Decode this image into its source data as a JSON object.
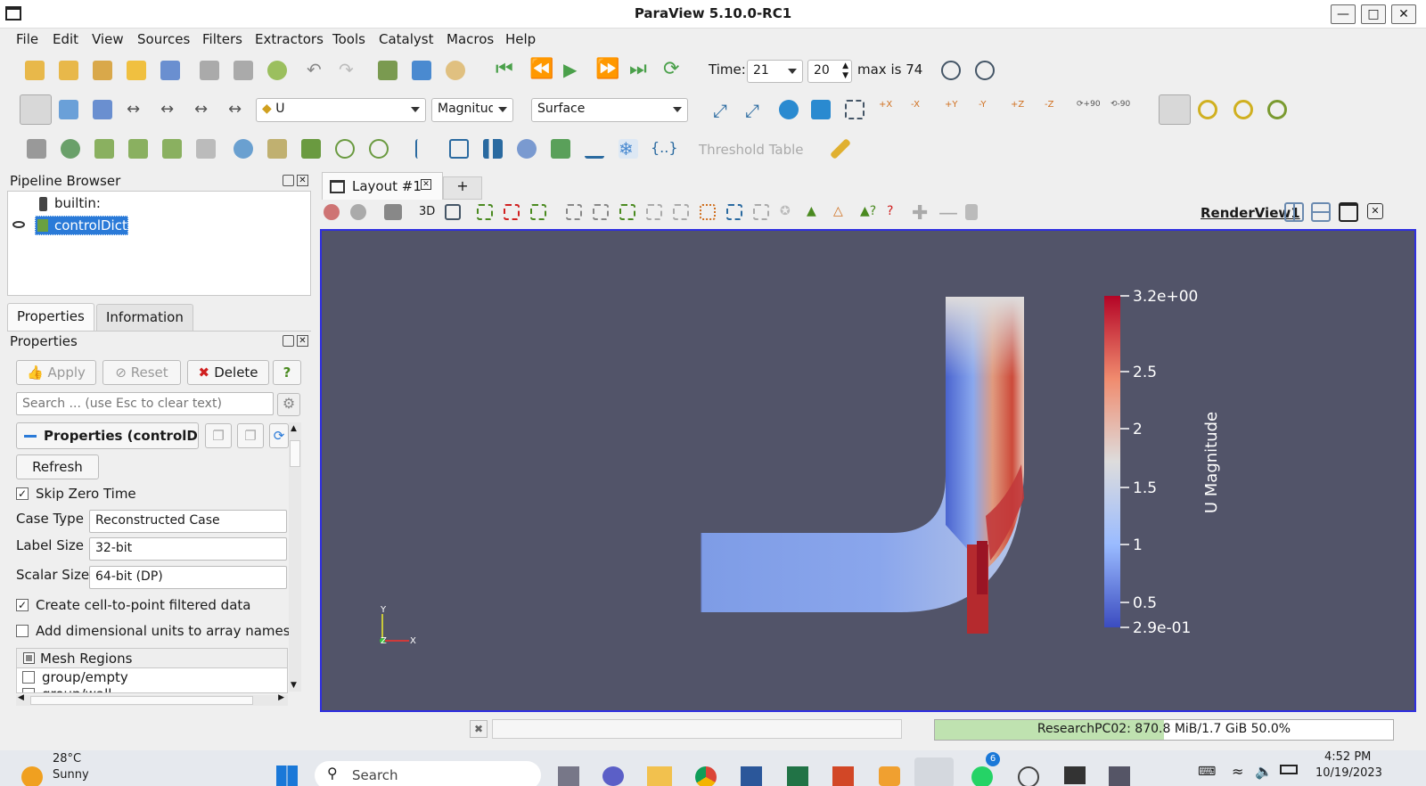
{
  "window": {
    "title": "ParaView 5.10.0-RC1"
  },
  "menu": [
    "File",
    "Edit",
    "View",
    "Sources",
    "Filters",
    "Extractors",
    "Tools",
    "Catalyst",
    "Macros",
    "Help"
  ],
  "toolbar": {
    "time_label": "Time:",
    "time_value": "21",
    "time_index": "20",
    "max_text": "max is 74",
    "array_name": "U",
    "component": "Magnitude",
    "representation": "Surface",
    "threshold_table": "Threshold Table",
    "rotate_plus": "+90",
    "rotate_minus": "-90"
  },
  "pipeline": {
    "header": "Pipeline Browser",
    "items": [
      {
        "label": "builtin:"
      },
      {
        "label": "controlDict"
      }
    ]
  },
  "tabs": {
    "properties": "Properties",
    "information": "Information"
  },
  "properties": {
    "header": "Properties",
    "apply": "Apply",
    "reset": "Reset",
    "delete": "Delete",
    "help": "?",
    "search_placeholder": "Search ... (use Esc to clear text)",
    "section_title": "Properties (controlDict)",
    "refresh": "Refresh",
    "skip_zero_time": "Skip Zero Time",
    "case_type_label": "Case Type",
    "case_type_value": "Reconstructed Case",
    "label_size_label": "Label Size",
    "label_size_value": "32-bit",
    "scalar_size_label": "Scalar Size",
    "scalar_size_value": "64-bit (DP)",
    "cell_to_point": "Create cell-to-point filtered data",
    "dim_units": "Add dimensional units to array names",
    "mesh_regions": "Mesh Regions",
    "regions": [
      "group/empty",
      "group/wall"
    ]
  },
  "layout": {
    "tab": "Layout #1",
    "add": "+",
    "view_name": "RenderView1",
    "btn_3d": "3D"
  },
  "colorbar": {
    "title": "U Magnitude",
    "ticks": [
      "3.2e+00",
      "2.5",
      "2",
      "1.5",
      "1",
      "0.5",
      "2.9e-01"
    ],
    "colors": [
      "#b40426",
      "#f08b6e",
      "#dddcdc",
      "#9abbff",
      "#3b4cc0"
    ]
  },
  "axes": {
    "y": "Y",
    "z": "Z",
    "x": "X"
  },
  "status": {
    "memory": "ResearchPC02: 870.8 MiB/1.7 GiB 50.0%",
    "memory_fraction": 0.5
  },
  "taskbar": {
    "temp": "28°C",
    "weather": "Sunny",
    "search": "Search",
    "time": "4:52 PM",
    "date": "10/19/2023",
    "badge": "6"
  }
}
